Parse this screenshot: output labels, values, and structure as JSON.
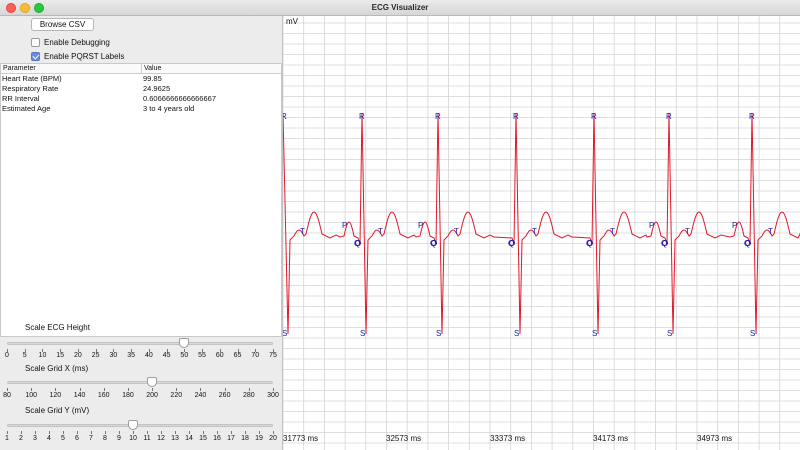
{
  "window": {
    "title": "ECG Visualizer"
  },
  "controls": {
    "browse_label": "Browse CSV",
    "debug_label": "Enable Debugging",
    "debug_checked": false,
    "pqrst_label": "Enable PQRST Labels",
    "pqrst_checked": true
  },
  "table": {
    "headers": [
      "Parameter",
      "Value"
    ],
    "rows": [
      [
        "Heart Rate (BPM)",
        "99.85"
      ],
      [
        "Respiratory Rate",
        "24.9625"
      ],
      [
        "RR Interval",
        "0.6066666666666667"
      ],
      [
        "Estimated Age",
        "3 to 4 years old"
      ]
    ]
  },
  "sliders": [
    {
      "title": "Scale ECG Height",
      "labels": [
        "0",
        "5",
        "10",
        "15",
        "20",
        "25",
        "30",
        "35",
        "40",
        "45",
        "50",
        "55",
        "60",
        "65",
        "70",
        "75"
      ],
      "min": 0,
      "max": 75,
      "value": 50
    },
    {
      "title": "Scale Grid X (ms)",
      "labels": [
        "80",
        "100",
        "120",
        "140",
        "160",
        "180",
        "200",
        "220",
        "240",
        "260",
        "280",
        "300"
      ],
      "min": 80,
      "max": 300,
      "value": 200
    },
    {
      "title": "Scale Grid Y (mV)",
      "labels": [
        "1",
        "2",
        "3",
        "4",
        "5",
        "6",
        "7",
        "8",
        "9",
        "10",
        "11",
        "12",
        "13",
        "14",
        "15",
        "16",
        "17",
        "18",
        "19",
        "20"
      ],
      "min": 1,
      "max": 20,
      "value": 10
    }
  ],
  "plot": {
    "y_unit": "mV",
    "x_labels": [
      "31773 ms",
      "32573 ms",
      "33373 ms",
      "34173 ms",
      "34973 ms"
    ],
    "line_color": "#e0192a",
    "grid_color": "#d4d4d4",
    "annotation_color": "#1a1aa8"
  },
  "chart_data": {
    "type": "line",
    "ylabel": "mV",
    "x_tick_labels": [
      "31773 ms",
      "32573 ms",
      "33373 ms",
      "34173 ms",
      "34973 ms"
    ],
    "r_peak_count": 7,
    "pqrst_labels": [
      "P",
      "Q",
      "R",
      "S",
      "T"
    ],
    "beats": [
      {
        "labels": [
          "R",
          "S",
          "T"
        ]
      },
      {
        "labels": [
          "P",
          "Q",
          "R",
          "S",
          "T"
        ]
      },
      {
        "labels": [
          "P",
          "Q",
          "R",
          "S",
          "T"
        ]
      },
      {
        "labels": [
          "Q",
          "R",
          "S",
          "T"
        ]
      },
      {
        "labels": [
          "Q",
          "R",
          "S",
          "T"
        ]
      },
      {
        "labels": [
          "P",
          "Q",
          "R",
          "S",
          "T"
        ]
      },
      {
        "labels": [
          "P",
          "Q",
          "R",
          "S",
          "T"
        ]
      }
    ]
  }
}
